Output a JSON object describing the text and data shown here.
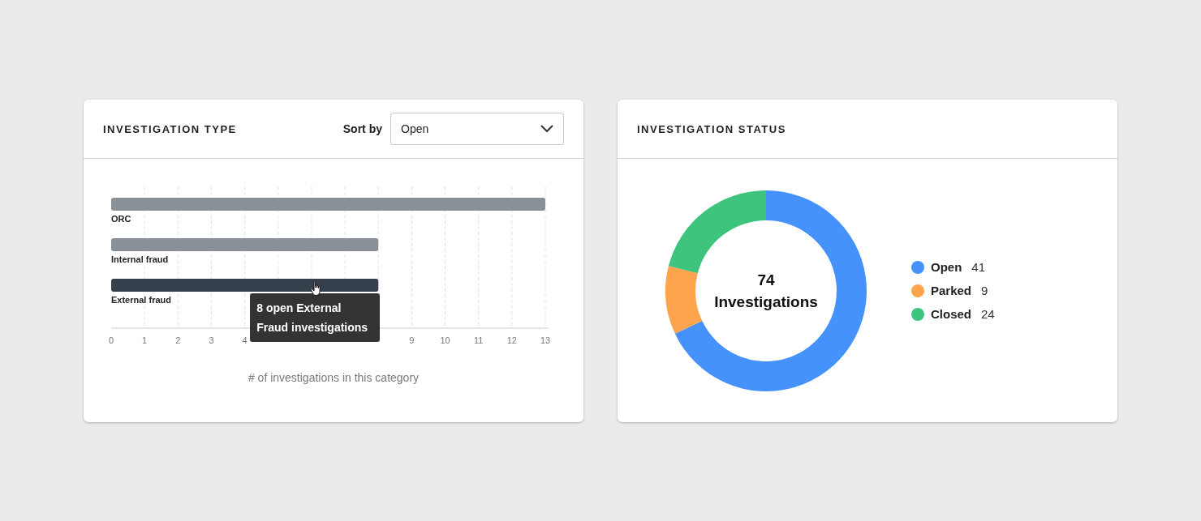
{
  "type_card": {
    "title": "INVESTIGATION TYPE",
    "sort": {
      "label": "Sort by",
      "value": "Open"
    },
    "chart_data": {
      "type": "bar",
      "orientation": "horizontal",
      "xlabel": "# of investigations in this category",
      "categories": [
        "ORC",
        "Internal fraud",
        "External fraud"
      ],
      "series": [
        {
          "values": [
            13,
            8,
            8
          ]
        }
      ],
      "xlim": [
        0,
        13
      ],
      "xticks": [
        0,
        1,
        2,
        3,
        4,
        9,
        10,
        11,
        12,
        13
      ],
      "grid": true
    },
    "bars": [
      {
        "selected": false
      },
      {
        "selected": false
      },
      {
        "selected": true
      }
    ],
    "tooltip": "8 open External Fraud investigations"
  },
  "status_card": {
    "title": "INVESTIGATION STATUS",
    "total": "74",
    "chart_data": {
      "type": "donut",
      "categories": [
        "Open",
        "Parked",
        "Closed"
      ],
      "series": [
        {
          "name": "Investigations",
          "values": [
            68,
            11,
            21
          ]
        }
      ]
    },
    "legend": [
      {
        "count": "41",
        "color": "#4592fd"
      },
      {
        "count": "9",
        "color": "#fda44d"
      },
      {
        "count": "24",
        "color": "#3ec47d"
      }
    ]
  }
}
